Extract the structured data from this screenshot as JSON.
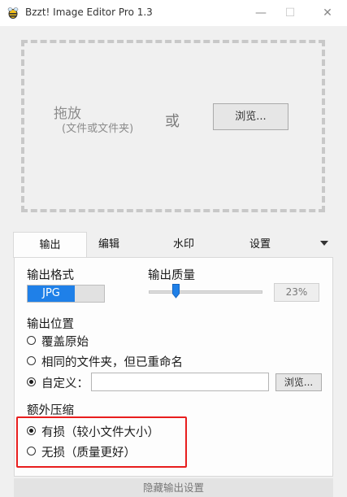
{
  "window": {
    "title": "Bzzt! Image Editor Pro 1.3",
    "minimize_glyph": "—",
    "maximize_glyph": "☐",
    "close_glyph": "✕"
  },
  "drop": {
    "label": "拖放",
    "sub_label": "(文件或文件夹)",
    "or_label": "或",
    "browse_label": "浏览..."
  },
  "tabs": [
    {
      "label": "输出",
      "active": true
    },
    {
      "label": "编辑",
      "active": false
    },
    {
      "label": "水印",
      "active": false
    },
    {
      "label": "设置",
      "active": false
    }
  ],
  "output": {
    "format_label": "输出格式",
    "format_value": "JPG",
    "quality_label": "输出质量",
    "quality_value": "23%",
    "quality_fraction": 0.23,
    "location_label": "输出位置",
    "location_options": [
      {
        "label": "覆盖原始",
        "checked": false
      },
      {
        "label": "相同的文件夹，但已重命名",
        "checked": false
      },
      {
        "label": "自定义：",
        "checked": true
      }
    ],
    "custom_path": "",
    "browse_label": "浏览...",
    "compression_label": "额外压缩",
    "compression_options": [
      {
        "label": "有损（较小文件大小）",
        "checked": true
      },
      {
        "label": "无损（质量更好）",
        "checked": false
      }
    ]
  },
  "footer": {
    "hide_label": "隐藏输出设置"
  },
  "colors": {
    "accent": "#1f80e8",
    "highlight": "#e81e1e"
  }
}
